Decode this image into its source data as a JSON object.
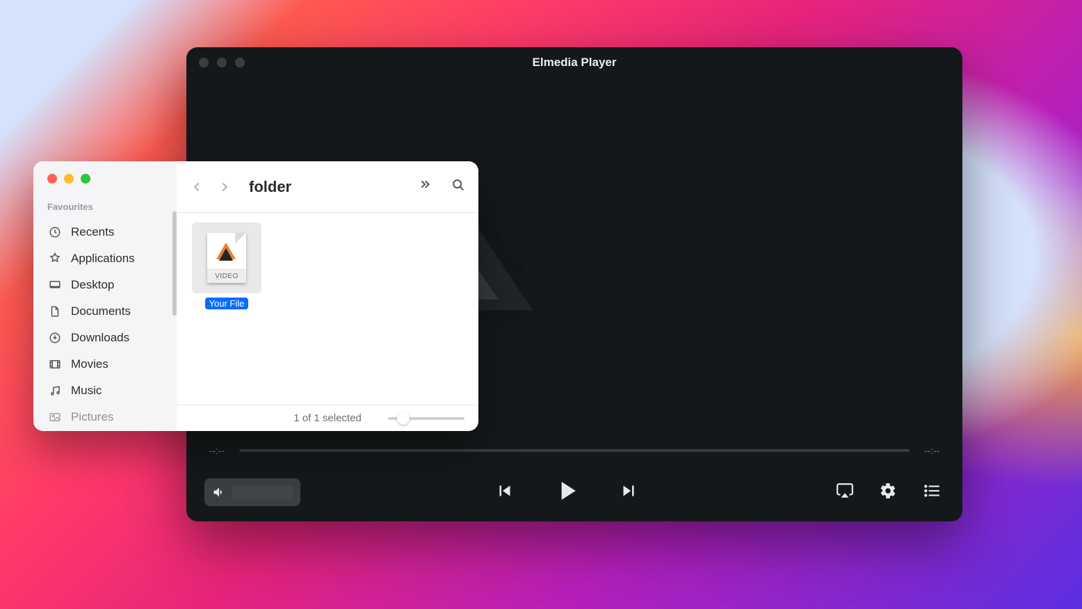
{
  "player": {
    "title": "Elmedia Player",
    "time_elapsed": "--:--",
    "time_remaining": "--:--",
    "drop_file": {
      "name": "Your File",
      "badge": "VIDEO"
    }
  },
  "finder": {
    "title": "folder",
    "sidebar": {
      "heading": "Favourites",
      "items": [
        {
          "label": "Recents",
          "icon": "clock"
        },
        {
          "label": "Applications",
          "icon": "apps"
        },
        {
          "label": "Desktop",
          "icon": "desktop"
        },
        {
          "label": "Documents",
          "icon": "document"
        },
        {
          "label": "Downloads",
          "icon": "download"
        },
        {
          "label": "Movies",
          "icon": "movies"
        },
        {
          "label": "Music",
          "icon": "music"
        },
        {
          "label": "Pictures",
          "icon": "pictures"
        }
      ]
    },
    "file": {
      "name": "Your File",
      "badge": "VIDEO"
    },
    "status": "1 of 1 selected"
  }
}
